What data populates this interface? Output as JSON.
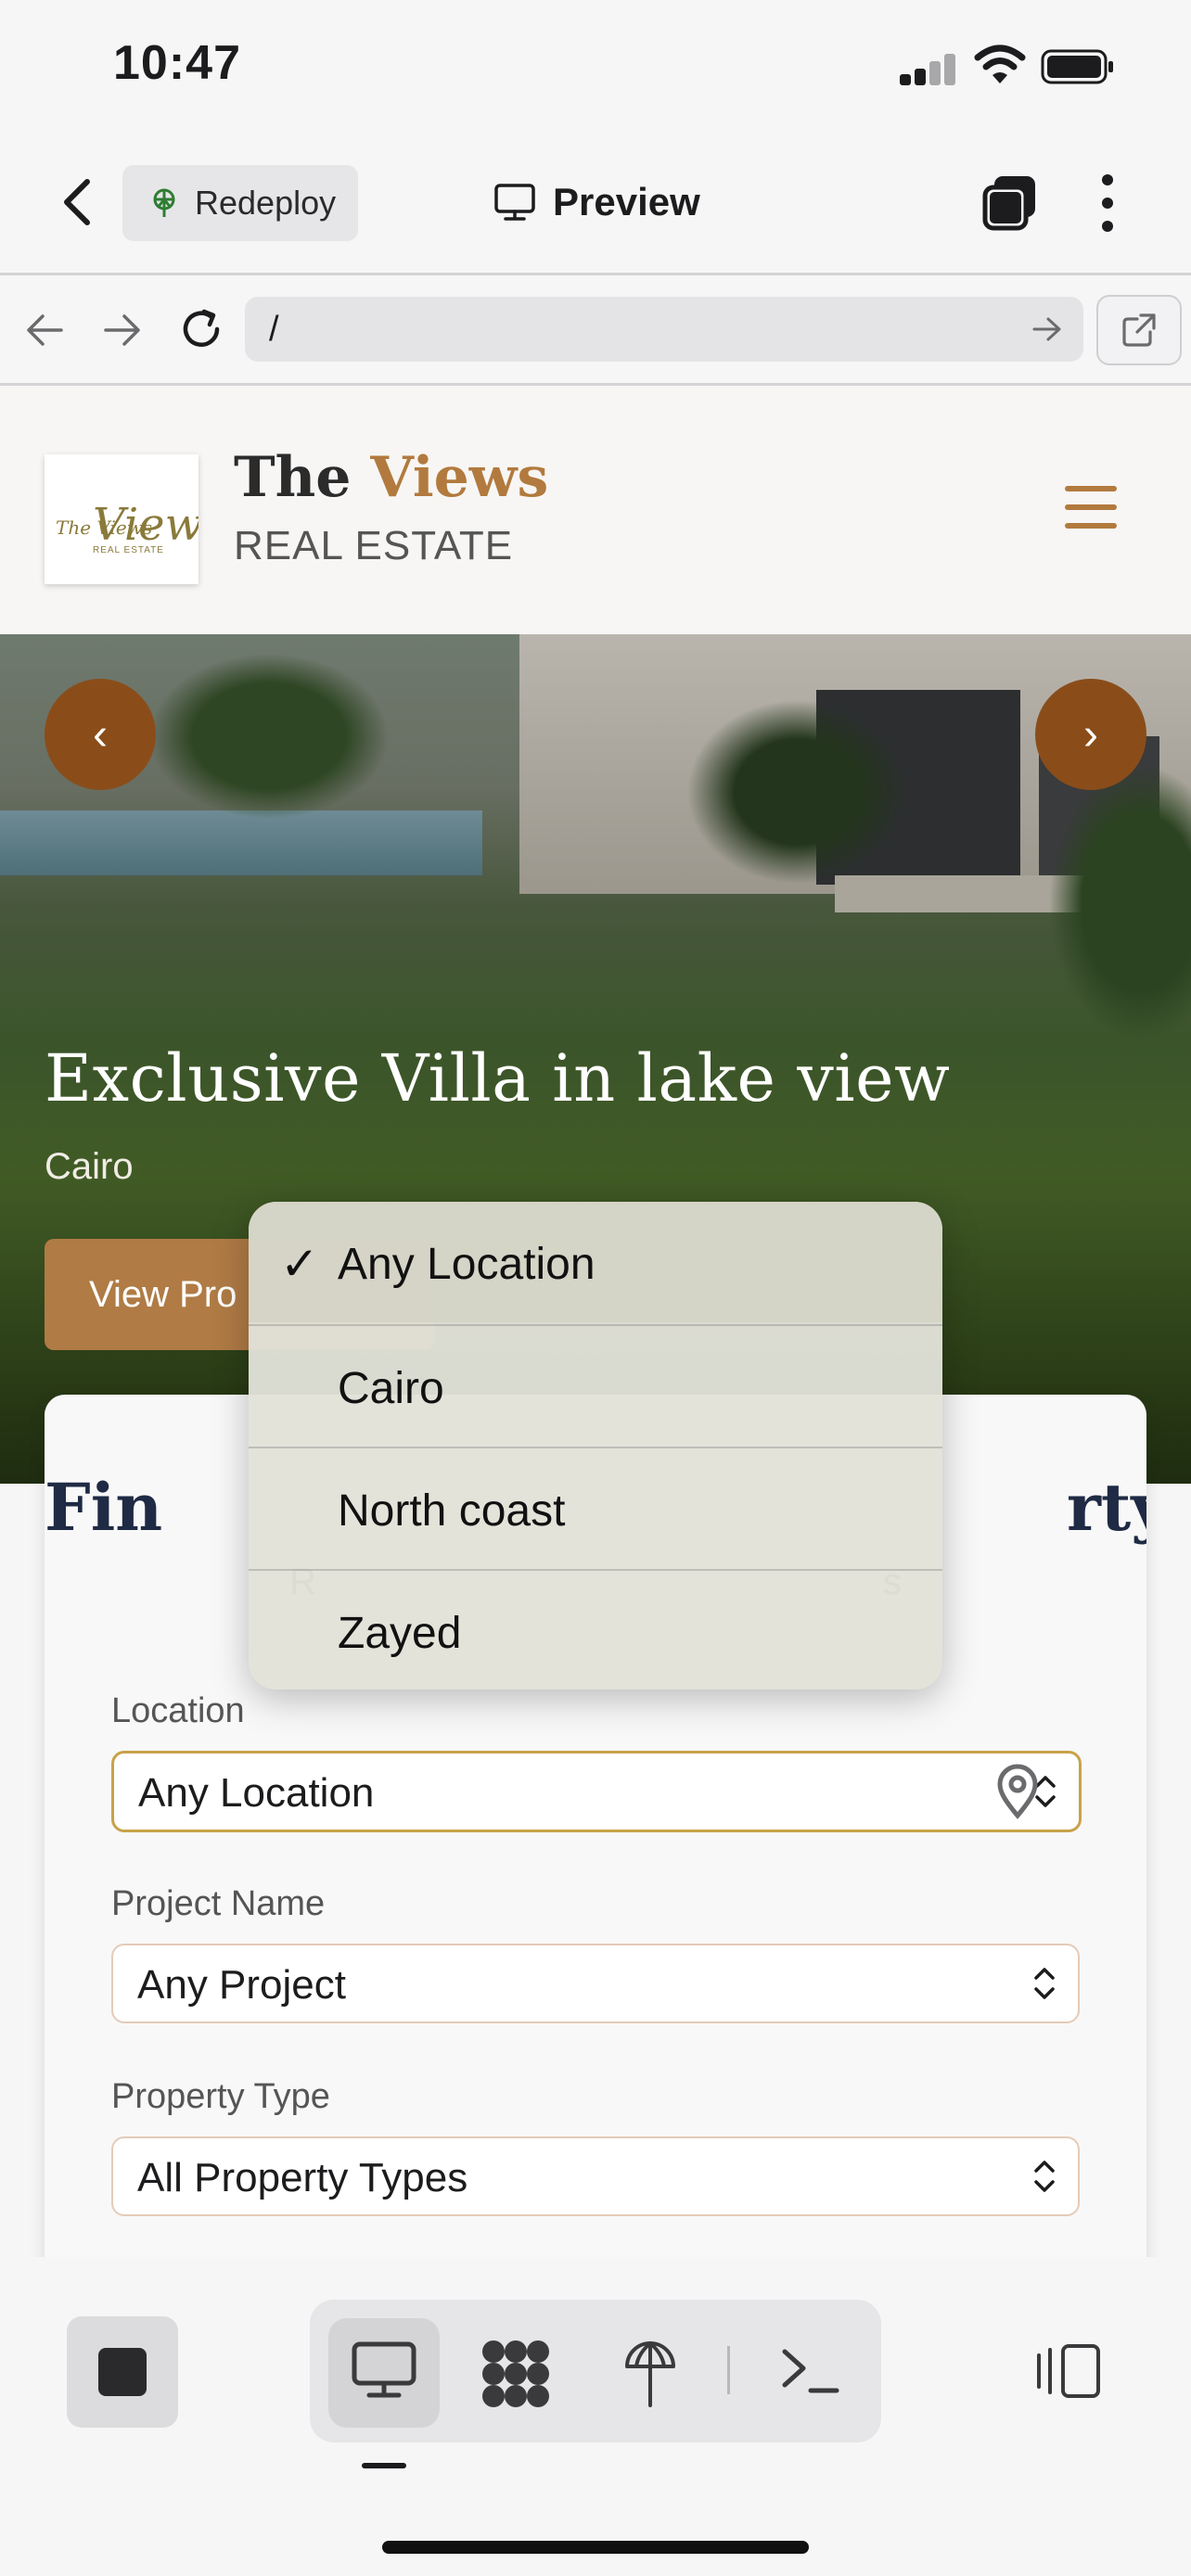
{
  "status_bar": {
    "time": "10:47"
  },
  "app_bar": {
    "redeploy_label": "Redeploy",
    "preview_label": "Preview"
  },
  "url_bar": {
    "url": "/"
  },
  "site": {
    "brand_title_part1": "The",
    "brand_title_part2": "Views",
    "brand_subtitle": "REAL ESTATE",
    "logo_text": "The Views",
    "logo_subtext": "REAL ESTATE",
    "accent_color": "#b27a3e"
  },
  "hero": {
    "title": "Exclusive Villa in lake view",
    "location": "Cairo",
    "cta_label": "View Pro",
    "prev_glyph": "‹",
    "next_glyph": "›"
  },
  "search": {
    "title": "Fin                                        rty",
    "subtitle": "R                                                       s",
    "location_label": "Location",
    "location_value": "Any Location",
    "project_label": "Project Name",
    "project_value": "Any Project",
    "type_label": "Property Type",
    "type_value": "All Property Types"
  },
  "location_dropdown": {
    "options": [
      {
        "label": "Any Location",
        "selected": true,
        "check": "✓"
      },
      {
        "label": "Cairo",
        "selected": false,
        "check": ""
      },
      {
        "label": "North coast",
        "selected": false,
        "check": ""
      },
      {
        "label": "Zayed",
        "selected": false,
        "check": ""
      }
    ]
  },
  "toolbar": {
    "icons": [
      "stop-icon",
      "preview-desktop-icon",
      "apps-icon",
      "deploy-icon",
      "shell-icon",
      "layout-icon"
    ],
    "shell_glyph": ">_"
  }
}
